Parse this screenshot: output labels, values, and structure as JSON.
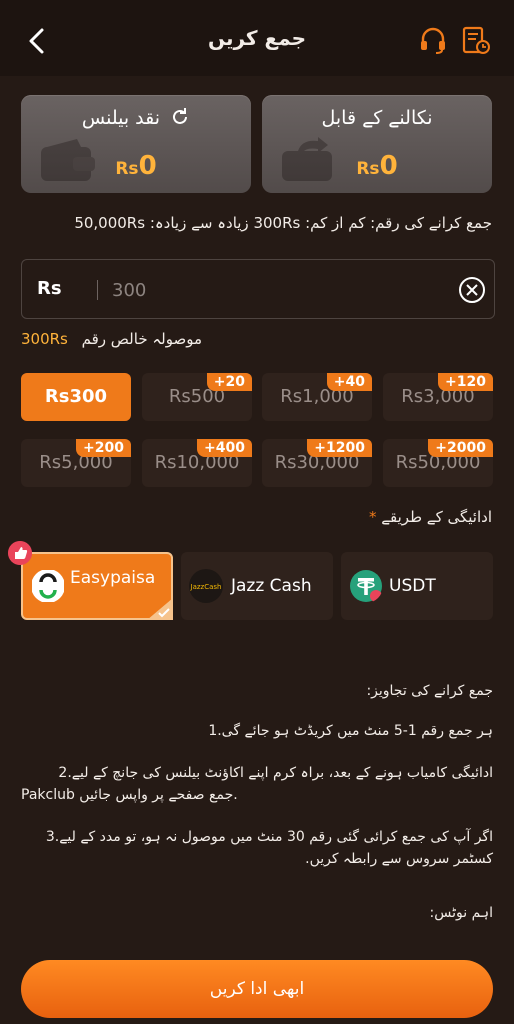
{
  "header": {
    "title": "جمع کریں"
  },
  "cards": [
    {
      "title": "نقد بیلنس",
      "currency": "Rs",
      "amount": "0"
    },
    {
      "title": "نکالنے کے قابل",
      "currency": "Rs",
      "amount": "0"
    }
  ],
  "limit_text": "جمع کرانے کی رقم: کم از کم: 300Rs زیادہ سے زیادہ: 50,000Rs",
  "amount_input": {
    "currency": "Rs",
    "placeholder": "300"
  },
  "net_received": {
    "label": "موصولہ خالص رقم",
    "value": "300Rs"
  },
  "presets": [
    {
      "amount": "Rs300",
      "bonus": "",
      "selected": true
    },
    {
      "amount": "Rs500",
      "bonus": "+20"
    },
    {
      "amount": "Rs1,000",
      "bonus": "+40"
    },
    {
      "amount": "Rs3,000",
      "bonus": "+120"
    },
    {
      "amount": "Rs5,000",
      "bonus": "+200"
    },
    {
      "amount": "Rs10,000",
      "bonus": "+400"
    },
    {
      "amount": "Rs30,000",
      "bonus": "+1200"
    },
    {
      "amount": "Rs50,000",
      "bonus": "+2000"
    }
  ],
  "payment": {
    "label": "ادائیگی کے طریقے",
    "required_mark": "*",
    "methods": [
      {
        "name": "Easypaisa",
        "selected": true
      },
      {
        "name": "Jazz Cash",
        "logo_text": "JazzCash"
      },
      {
        "name": "USDT"
      }
    ]
  },
  "tips": {
    "heading": "جمع کرانے کی تجاویز:",
    "items": [
      "ہر جمع رقم 1-5 منٹ میں کریڈٹ ہو جائے گی.1",
      "ادائیگی کامیاب ہونے کے بعد، براہ کرم اپنے اکاؤنٹ بیلنس کی جانچ کے لیے.2",
      "Pakclub جمع صفحے پر واپس جائیں.",
      "اگر آپ کی جمع کرائی گئی رقم 30 منٹ میں موصول نہ ہو، تو مدد کے لیے.3",
      "کسٹمر سروس سے رابطہ کریں."
    ],
    "notice": "اہم نوٹس:"
  },
  "pay_button": "ابھی ادا کریں",
  "colors": {
    "accent": "#ef7a1a",
    "amount": "#ffb33b",
    "background": "#251a15"
  }
}
